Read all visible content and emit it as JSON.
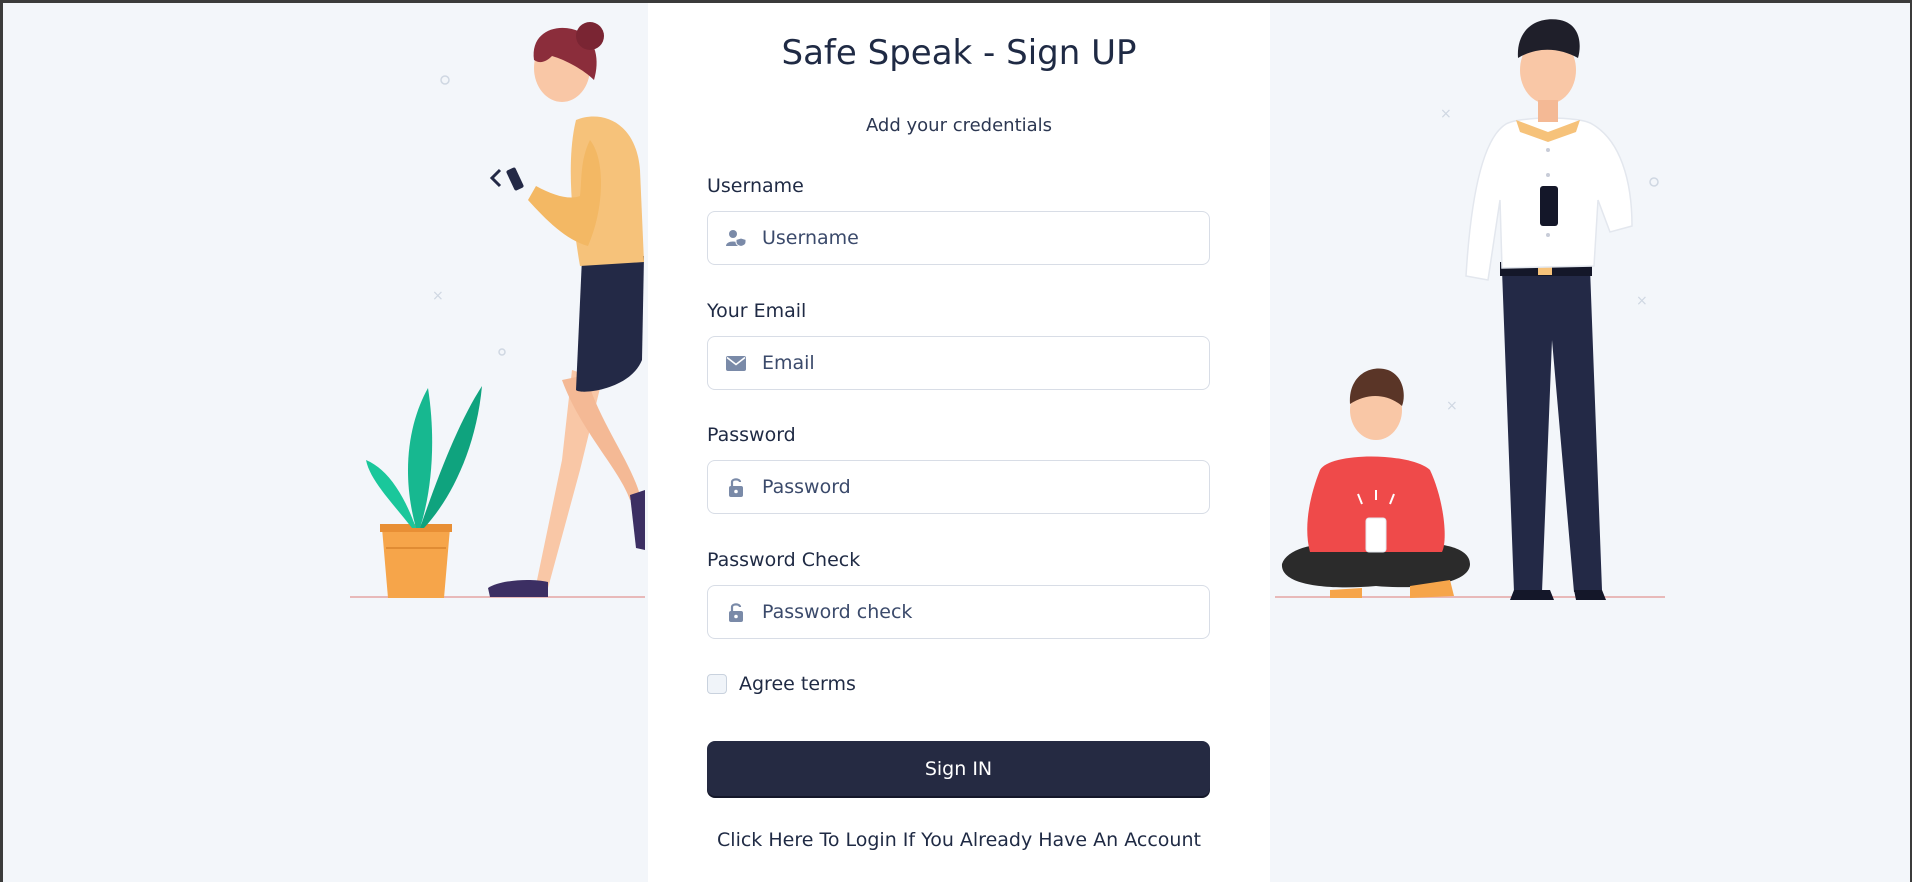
{
  "header": {
    "title": "Safe Speak - Sign UP",
    "subtitle": "Add your credentials"
  },
  "form": {
    "fields": [
      {
        "label": "Username",
        "placeholder": "Username",
        "value": "",
        "icon": "user-shield-icon"
      },
      {
        "label": "Your Email",
        "placeholder": "Email",
        "value": "",
        "icon": "envelope-icon"
      },
      {
        "label": "Password",
        "placeholder": "Password",
        "value": "",
        "icon": "unlock-icon"
      },
      {
        "label": "Password Check",
        "placeholder": "Password check",
        "value": "",
        "icon": "unlock-icon"
      }
    ],
    "agree_label": "Agree terms",
    "agree_checked": false,
    "submit_label": "Sign IN",
    "login_link": "Click Here To Login If You Already Have An Account"
  },
  "colors": {
    "page_bg": "#f3f6fa",
    "card_bg": "#ffffff",
    "button_bg": "#252a42",
    "icon": "#7a8aa8"
  },
  "illustrations": {
    "left": "woman-with-phone-and-plant-illustration",
    "right": "man-standing-and-boy-sitting-with-phones-illustration"
  }
}
